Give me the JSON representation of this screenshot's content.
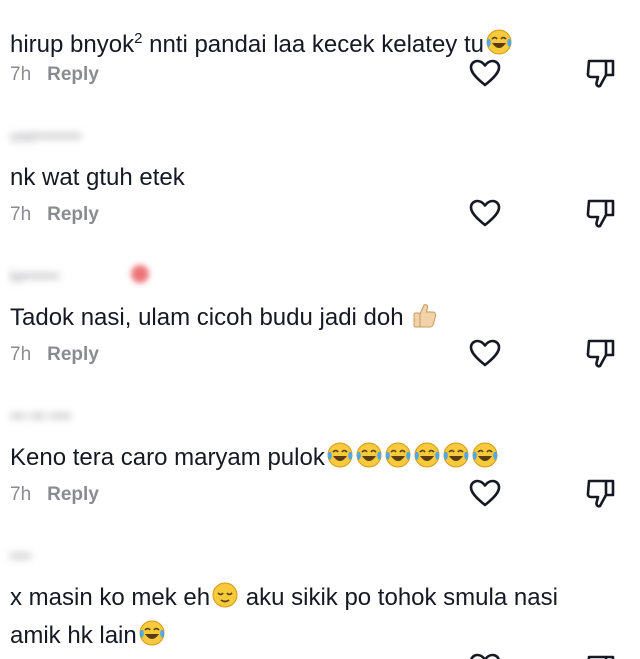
{
  "comments": [
    {
      "username": "",
      "text_parts": [
        "hirup bnyok",
        "2",
        " nnti pandai laa kecek kelatey tu"
      ],
      "emojis": [
        "face-with-tears-of-joy"
      ],
      "time": "7h",
      "reply_label": "Reply"
    },
    {
      "username": "user••••••••",
      "text": "nk wat gtuh etek",
      "time": "7h",
      "reply_label": "Reply"
    },
    {
      "username": "ta•••••••",
      "text": "Tadok nasi, ulam cicoh budu jadi doh",
      "emojis": [
        "thumbs-up"
      ],
      "time": "7h",
      "reply_label": "Reply"
    },
    {
      "username": "••• ••• ••••",
      "text": "Keno tera caro maryam pulok",
      "emojis": [
        "face-with-tears-of-joy",
        "face-with-tears-of-joy",
        "face-with-tears-of-joy",
        "face-with-tears-of-joy",
        "face-with-tears-of-joy",
        "face-with-tears-of-joy"
      ],
      "time": "7h",
      "reply_label": "Reply"
    },
    {
      "username": "••••",
      "text_line1_a": "x masin ko mek eh",
      "text_line1_b": " aku sikik po tohok smula nasi",
      "text_line2": "amik hk lain",
      "emojis": [
        "relieved-face",
        "face-with-tears-of-joy"
      ]
    }
  ],
  "colors": {
    "text": "#161823",
    "muted": "#8a8b91",
    "icon": "#161823"
  },
  "icons": {
    "like": "heart-outline-icon",
    "dislike": "thumbs-down-outline-icon"
  }
}
